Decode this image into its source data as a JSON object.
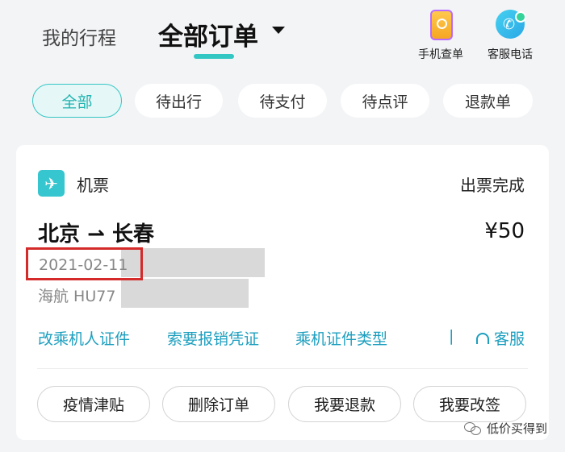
{
  "header": {
    "tab_my_trips": "我的行程",
    "tab_all_orders": "全部订单",
    "phone_check_label": "手机查单",
    "service_phone_label": "客服电话"
  },
  "filters": [
    "全部",
    "待出行",
    "待支付",
    "待点评",
    "退款单"
  ],
  "order": {
    "category": "机票",
    "status": "出票完成",
    "route_from": "北京",
    "route_to": "长春",
    "price": "¥50",
    "date": "2021-02-11",
    "flight": "海航 HU77",
    "links": [
      "改乘机人证件",
      "索要报销凭证",
      "乘机证件类型"
    ],
    "separator": "|",
    "service": "客服",
    "actions": [
      "疫情津贴",
      "删除订单",
      "我要退款",
      "我要改签"
    ]
  },
  "watermark": "低价买得到",
  "colors": {
    "accent": "#33c7c4",
    "link": "#1d9fbf",
    "highlight_box": "#d42a2a"
  }
}
